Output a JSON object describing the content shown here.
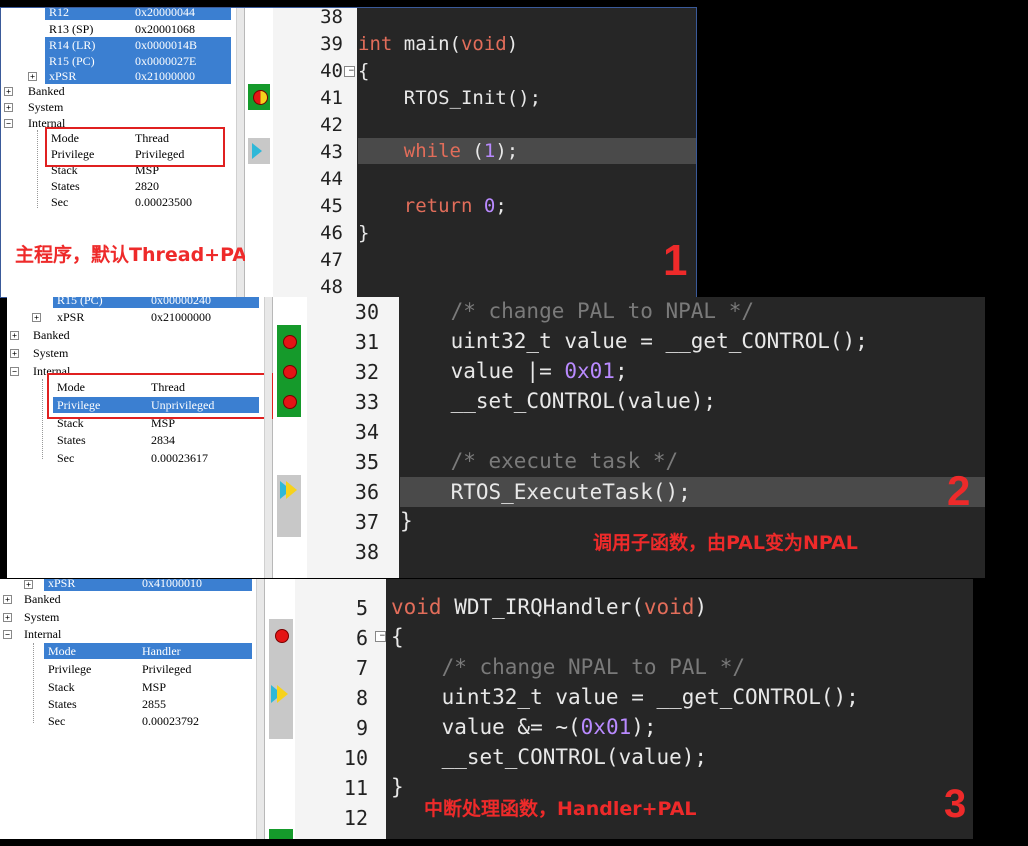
{
  "panel1": {
    "registers": [
      {
        "name": "R12",
        "value": "0x20000044",
        "selected": true
      },
      {
        "name": "R13 (SP)",
        "value": "0x20001068",
        "selected": false
      },
      {
        "name": "R14 (LR)",
        "value": "0x0000014B",
        "selected": true
      },
      {
        "name": "R15 (PC)",
        "value": "0x0000027E",
        "selected": true
      },
      {
        "name": "xPSR",
        "value": "0x21000000",
        "selected": true
      }
    ],
    "groups": [
      "Banked",
      "System",
      "Internal"
    ],
    "internal": [
      {
        "name": "Mode",
        "value": "Thread",
        "selected": false
      },
      {
        "name": "Privilege",
        "value": "Privileged",
        "selected": false
      },
      {
        "name": "Stack",
        "value": "MSP",
        "selected": false
      },
      {
        "name": "States",
        "value": "2820",
        "selected": false
      },
      {
        "name": "Sec",
        "value": "0.00023500",
        "selected": false
      }
    ],
    "line_numbers": [
      "38",
      "39",
      "40",
      "41",
      "42",
      "43",
      "44",
      "45",
      "46",
      "47",
      "48"
    ],
    "code": [
      "",
      "int main(void)",
      "{",
      "    RTOS_Init();",
      "",
      "    while (1);",
      "",
      "    return 0;",
      "}",
      "",
      ""
    ],
    "annotation": "主程序，默认Thread+PAL",
    "number": "1"
  },
  "panel2": {
    "registers": [
      {
        "name": "R15 (PC)",
        "value": "0x00000240",
        "selected": true
      },
      {
        "name": "xPSR",
        "value": "0x21000000",
        "selected": false
      }
    ],
    "groups": [
      "Banked",
      "System",
      "Internal"
    ],
    "internal": [
      {
        "name": "Mode",
        "value": "Thread",
        "selected": false
      },
      {
        "name": "Privilege",
        "value": "Unprivileged",
        "selected": true
      },
      {
        "name": "Stack",
        "value": "MSP",
        "selected": false
      },
      {
        "name": "States",
        "value": "2834",
        "selected": false
      },
      {
        "name": "Sec",
        "value": "0.00023617",
        "selected": false
      }
    ],
    "line_numbers": [
      "30",
      "31",
      "32",
      "33",
      "34",
      "35",
      "36",
      "37",
      "38"
    ],
    "code": [
      "    /* change PAL to NPAL */",
      "    uint32_t value = __get_CONTROL();",
      "    value |= 0x01;",
      "    __set_CONTROL(value);",
      "",
      "    /* execute task */",
      "    RTOS_ExecuteTask();",
      "}",
      ""
    ],
    "annotation": "调用子函数，由PAL变为NPAL",
    "number": "2"
  },
  "panel3": {
    "registers": [
      {
        "name": "xPSR",
        "value": "0x41000010",
        "selected": true
      }
    ],
    "groups": [
      "Banked",
      "System",
      "Internal"
    ],
    "internal": [
      {
        "name": "Mode",
        "value": "Handler",
        "selected": true
      },
      {
        "name": "Privilege",
        "value": "Privileged",
        "selected": false
      },
      {
        "name": "Stack",
        "value": "MSP",
        "selected": false
      },
      {
        "name": "States",
        "value": "2855",
        "selected": false
      },
      {
        "name": "Sec",
        "value": "0.00023792",
        "selected": false
      }
    ],
    "line_numbers": [
      "5",
      "6",
      "7",
      "8",
      "9",
      "10",
      "11",
      "12"
    ],
    "code": [
      "void WDT_IRQHandler(void)",
      "{",
      "    /* change NPAL to PAL */",
      "    uint32_t value = __get_CONTROL();",
      "    value &= ~(0x01);",
      "    __set_CONTROL(value);",
      "}",
      ""
    ],
    "annotation": "中断处理函数，Handler+PAL",
    "number": "3"
  },
  "colors": {
    "accent_red": "#ee2a2a",
    "selection_blue": "#3b7fd1",
    "breakpoint_red": "#e41515",
    "exec_green": "#159a2b",
    "keyword": "#e26d5a",
    "number": "#b98aff",
    "comment": "#7a7a7a",
    "editor_bg": "#262626"
  }
}
